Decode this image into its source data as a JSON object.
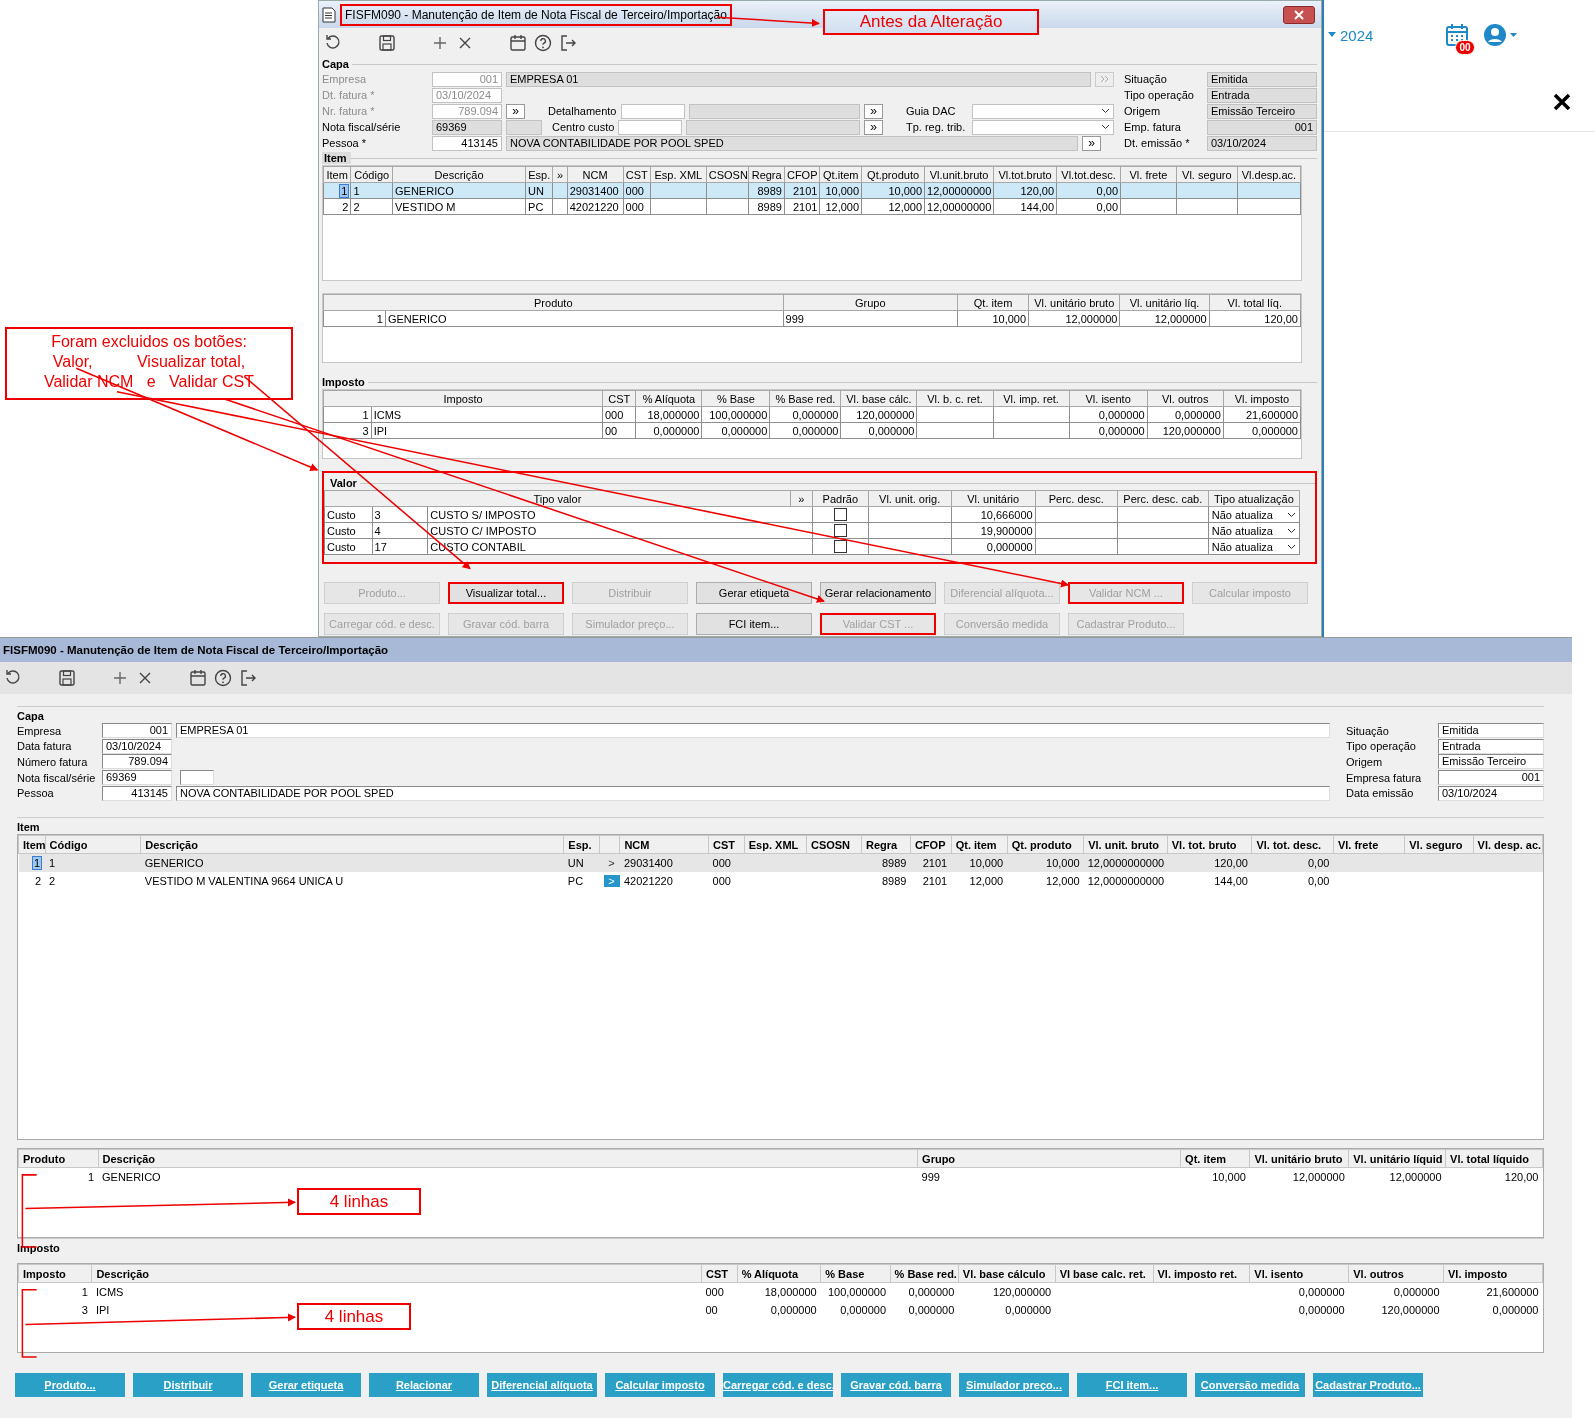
{
  "old_window": {
    "title": "FISFM090 - Manutenção de Item de Nota Fiscal de Terceiro/Importação",
    "title_highlighted": true,
    "note": "Antes da Alteração",
    "capa": {
      "heading": "Capa",
      "rows": [
        [
          {
            "kind": "label",
            "text": "Empresa",
            "disabled": true
          },
          {
            "kind": "code",
            "value": "001",
            "disabled": true
          },
          {
            "kind": "desc",
            "value": "EMPRESA 01",
            "readonly": true
          },
          {
            "kind": "lookup"
          }
        ],
        [
          {
            "kind": "label",
            "text": "Dt. fatura *",
            "disabled": true
          },
          {
            "kind": "short",
            "value": "03/10/2024",
            "disabled": true
          }
        ],
        [
          {
            "kind": "label",
            "text": "Nr. fatura *",
            "disabled": true
          },
          {
            "kind": "code",
            "value": "789.094",
            "disabled": true
          },
          {
            "kind": "more",
            "text": "»"
          },
          {
            "kind": "sublabel",
            "text": "Detalhamento"
          },
          {
            "kind": "input"
          },
          {
            "kind": "blank"
          },
          {
            "kind": "more",
            "text": "»"
          },
          {
            "kind": "sublabel",
            "text": "Guia DAC"
          },
          {
            "kind": "select"
          }
        ],
        [
          {
            "kind": "label",
            "text": "Nota fiscal/série",
            "disabled": false
          },
          {
            "kind": "short",
            "value": "69369",
            "readonly": true
          },
          {
            "kind": "stub"
          },
          {
            "kind": "sublabel",
            "text": "Centro custo"
          },
          {
            "kind": "input"
          },
          {
            "kind": "blank"
          },
          {
            "kind": "more",
            "text": "»"
          },
          {
            "kind": "sublabel",
            "text": "Tp. reg. trib."
          },
          {
            "kind": "select"
          }
        ],
        [
          {
            "kind": "label",
            "text": "Pessoa *",
            "disabled": false
          },
          {
            "kind": "code",
            "value": "413145"
          },
          {
            "kind": "desc",
            "value": "NOVA CONTABILIDADE POR POOL SPED",
            "readonly": true
          },
          {
            "kind": "more",
            "text": "»"
          }
        ]
      ],
      "status": [
        {
          "label": "Situação",
          "value": "Emitida",
          "kind": "text"
        },
        {
          "label": "Tipo operação",
          "value": "Entrada",
          "kind": "text"
        },
        {
          "label": "Origem",
          "value": "Emissão Terceiro",
          "kind": "text"
        },
        {
          "label": "Emp. fatura",
          "value": "001",
          "kind": "code"
        },
        {
          "label": "Dt. emissão *",
          "value": "03/10/2024",
          "kind": "text"
        }
      ]
    },
    "item": {
      "heading": "Item",
      "columns": [
        "Item",
        "Código",
        "Descrição",
        "Esp.",
        "»",
        "NCM",
        "CST",
        "Esp. XML",
        "CSOSN",
        "Regra",
        "CFOP",
        "Qt.item",
        "Qt.produto",
        "Vl.unit.bruto",
        "Vl.tot.bruto",
        "Vl.tot.desc.",
        "Vl. frete",
        "Vl. seguro",
        "Vl.desp.ac."
      ],
      "rows": [
        {
          "selected": true,
          "cells": [
            "1",
            "1",
            "GENERICO",
            "UN",
            null,
            "29031400",
            "000",
            null,
            null,
            "8989",
            "2101",
            "10,000",
            "10,000",
            "12,00000000",
            "120,00",
            "0,00",
            null,
            null,
            null
          ]
        },
        {
          "selected": false,
          "cells": [
            "2",
            "2",
            "VESTIDO M",
            "PC",
            null,
            "42021220",
            "000",
            null,
            null,
            "8989",
            "2101",
            "12,000",
            "12,000",
            "12,00000000",
            "144,00",
            "0,00",
            null,
            null,
            null
          ]
        }
      ]
    },
    "produto": {
      "columns": [
        {
          "label": "Produto",
          "colspan": 2
        },
        "Grupo",
        "Qt. item",
        "Vl. unitário bruto",
        "Vl. unitário líq.",
        "Vl. total líq."
      ],
      "rows": [
        {
          "cells": [
            "1",
            "GENERICO",
            "999",
            "10,000",
            "12,000000",
            "12,000000",
            "120,00"
          ]
        }
      ]
    },
    "imposto": {
      "heading": "Imposto",
      "columns": [
        {
          "label": "Imposto",
          "colspan": 2
        },
        "CST",
        "% Alíquota",
        "% Base",
        "% Base red.",
        "Vl. base cálc.",
        "Vl. b. c. ret.",
        "Vl. imp. ret.",
        "Vl. isento",
        "Vl. outros",
        "Vl. imposto"
      ],
      "rows": [
        {
          "cells": [
            "1",
            "ICMS",
            "000",
            "18,000000",
            "100,000000",
            "0,000000",
            "120,000000",
            null,
            null,
            "0,000000",
            "0,000000",
            "21,600000"
          ]
        },
        {
          "cells": [
            "3",
            "IPI",
            "00",
            "0,000000",
            "0,000000",
            "0,000000",
            "0,000000",
            null,
            null,
            "0,000000",
            "120,000000",
            "0,000000"
          ]
        }
      ]
    },
    "valor": {
      "heading": "Valor",
      "highlighted": true,
      "columns": [
        "Tipo valor",
        "»",
        "Padrão",
        "Vl. unit. orig.",
        "Vl. unitário",
        "Perc. desc.",
        "Perc. desc. cab.",
        "Tipo atualização"
      ],
      "rows": [
        {
          "type": "Custo",
          "code": "3",
          "description": "CUSTO S/ IMPOSTO",
          "default": false,
          "unit_value": "10,666000",
          "update": "Não atualiza"
        },
        {
          "type": "Custo",
          "code": "4",
          "description": "CUSTO C/ IMPOSTO",
          "default": false,
          "unit_value": "19,900000",
          "update": "Não atualiza"
        },
        {
          "type": "Custo",
          "code": "17",
          "description": "CUSTO CONTABIL",
          "default": false,
          "unit_value": "0,000000",
          "update": "Não atualiza"
        }
      ]
    },
    "buttons": [
      {
        "label": "Produto...",
        "disabled": true,
        "highlighted": false
      },
      {
        "label": "Visualizar total...",
        "disabled": false,
        "highlighted": true
      },
      {
        "label": "Distribuir",
        "disabled": true,
        "highlighted": false
      },
      {
        "label": "Gerar etiqueta",
        "disabled": false,
        "highlighted": false
      },
      {
        "label": "Gerar relacionamento",
        "disabled": false,
        "highlighted": false
      },
      {
        "label": "Diferencial alíquota...",
        "disabled": true,
        "highlighted": false
      },
      {
        "label": "Validar NCM ...",
        "disabled": true,
        "highlighted": true
      },
      {
        "label": "Calcular imposto",
        "disabled": true,
        "highlighted": false
      },
      {
        "label": "Carregar cód. e desc.",
        "disabled": true,
        "highlighted": false
      },
      {
        "label": "Gravar cód. barra",
        "disabled": true,
        "highlighted": false
      },
      {
        "label": "Simulador preço...",
        "disabled": true,
        "highlighted": false
      },
      {
        "label": "FCI item...",
        "disabled": false,
        "highlighted": false
      },
      {
        "label": "Validar CST ...",
        "disabled": true,
        "highlighted": true
      },
      {
        "label": "Conversão medida",
        "disabled": true,
        "highlighted": false
      },
      {
        "label": "Cadastrar Produto...",
        "disabled": true,
        "highlighted": false
      }
    ]
  },
  "annotation": {
    "text": "Foram excluidos os botões:\nValor,          Visualizar total,\nValidar NCM   e   Validar CST"
  },
  "header_panel": {
    "year": "2024",
    "notification_count": "00"
  },
  "new_window": {
    "title": "FISFM090 - Manutenção de Item de Nota Fiscal de Terceiro/Importação",
    "capa": {
      "heading": "Capa",
      "rows": [
        [
          {
            "kind": "label",
            "text": "Empresa"
          },
          {
            "kind": "code",
            "value": "001"
          },
          {
            "kind": "desc",
            "value": "EMPRESA 01"
          }
        ],
        [
          {
            "kind": "label",
            "text": "Data fatura"
          },
          {
            "kind": "short",
            "value": "03/10/2024"
          }
        ],
        [
          {
            "kind": "label",
            "text": "Número fatura"
          },
          {
            "kind": "code",
            "value": "789.094"
          }
        ],
        [
          {
            "kind": "label",
            "text": "Nota fiscal/série"
          },
          {
            "kind": "short",
            "value": "69369"
          },
          {
            "kind": "input"
          }
        ],
        [
          {
            "kind": "label",
            "text": "Pessoa"
          },
          {
            "kind": "code",
            "value": "413145"
          },
          {
            "kind": "desc",
            "value": "NOVA CONTABILIDADE POR POOL SPED"
          }
        ]
      ],
      "status": [
        {
          "label": "Situação",
          "value": "Emitida",
          "kind": "text"
        },
        {
          "label": "Tipo operação",
          "value": "Entrada",
          "kind": "text"
        },
        {
          "label": "Origem",
          "value": "Emissão Terceiro",
          "kind": "text"
        },
        {
          "label": "Empresa fatura",
          "value": "001",
          "kind": "code"
        },
        {
          "label": "Data emissão",
          "value": "03/10/2024",
          "kind": "text"
        }
      ]
    },
    "item": {
      "heading": "Item",
      "columns": [
        "Item",
        "Código",
        "Descrição",
        "Esp.",
        "",
        "NCM",
        "CST",
        "Esp. XML",
        "CSOSN",
        "Regra",
        "CFOP",
        "Qt. item",
        "Qt. produto",
        "Vl. unit. bruto",
        "Vl. tot. bruto",
        "Vl. tot. desc.",
        "Vl. frete",
        "Vl. seguro",
        "Vl. desp. ac."
      ],
      "rows": [
        {
          "selected": true,
          "lookup_active": false,
          "cells": [
            "1",
            "1",
            "GENERICO",
            "UN",
            ">",
            "29031400",
            "000",
            null,
            null,
            "8989",
            "2101",
            "10,000",
            "10,000",
            "12,0000000000",
            "120,00",
            "0,00",
            null,
            null,
            null
          ]
        },
        {
          "selected": false,
          "lookup_active": true,
          "cells": [
            "2",
            "2",
            "VESTIDO M VALENTINA 9664 UNICA U",
            "PC",
            ">",
            "42021220",
            "000",
            null,
            null,
            "8989",
            "2101",
            "12,000",
            "12,000",
            "12,0000000000",
            "144,00",
            "0,00",
            null,
            null,
            null
          ]
        }
      ]
    },
    "produto": {
      "columns": [
        "Produto",
        "Descrição",
        "Grupo",
        "Qt. item",
        "Vl. unitário bruto",
        "Vl. unitário líquid",
        "Vl. total líquido"
      ],
      "rows": [
        {
          "cells": [
            "1",
            "GENERICO",
            "999",
            "10,000",
            "12,000000",
            "12,000000",
            "120,00"
          ]
        }
      ],
      "note": "4 linhas"
    },
    "imposto": {
      "heading": "Imposto",
      "columns": [
        "Imposto",
        "Descrição",
        "CST",
        "% Alíquota",
        "% Base",
        "% Base red.",
        "Vl. base cálculo",
        "Vl base calc. ret.",
        "Vl. imposto ret.",
        "Vl. isento",
        "Vl. outros",
        "Vl. imposto"
      ],
      "rows": [
        {
          "cells": [
            "1",
            "ICMS",
            "000",
            "18,000000",
            "100,000000",
            "0,000000",
            "120,000000",
            null,
            null,
            "0,000000",
            "0,000000",
            "21,600000"
          ]
        },
        {
          "cells": [
            "3",
            "IPI",
            "00",
            "0,000000",
            "0,000000",
            "0,000000",
            "0,000000",
            null,
            null,
            "0,000000",
            "120,000000",
            "0,000000"
          ]
        }
      ],
      "note": "4 linhas"
    },
    "buttons": [
      {
        "label": "Produto..."
      },
      {
        "label": "Distribuir"
      },
      {
        "label": "Gerar etiqueta"
      },
      {
        "label": "Relacionar"
      },
      {
        "label": "Diferencial alíquota"
      },
      {
        "label": "Calcular imposto"
      },
      {
        "label": "Carregar cód. e desc."
      },
      {
        "label": "Gravar cód. barra"
      },
      {
        "label": "Simulador preço..."
      },
      {
        "label": "FCI item..."
      },
      {
        "label": "Conversão medida"
      },
      {
        "label": "Cadastrar Produto..."
      }
    ]
  }
}
